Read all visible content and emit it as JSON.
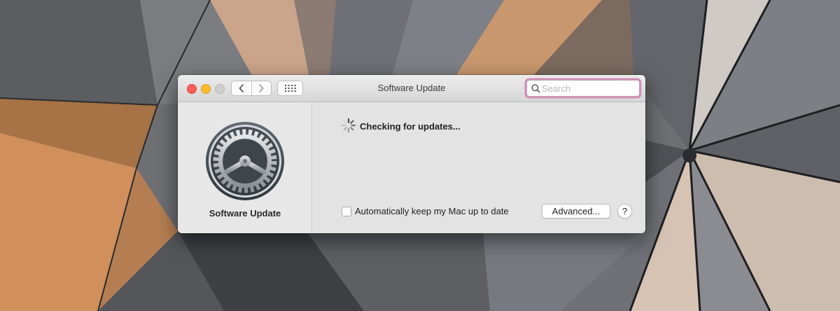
{
  "window": {
    "title": "Software Update",
    "controls": {
      "close_color": "#fc5f57",
      "minimize_color": "#fdbc2e",
      "zoom_color": "#cfcfcf"
    }
  },
  "toolbar": {
    "back_icon": "chevron-left-icon",
    "forward_icon": "chevron-right-icon",
    "show_all_icon": "grid-icon",
    "search": {
      "placeholder": "Search",
      "value": "",
      "focus_ring_color": "#d590b8"
    }
  },
  "sidebar": {
    "icon": "gear-icon",
    "pane_name": "Software Update"
  },
  "content": {
    "status_icon": "spinner-icon",
    "status_text": "Checking for updates...",
    "auto_update": {
      "label": "Automatically keep my Mac up to date",
      "checked": false
    },
    "advanced_label": "Advanced...",
    "help_label": "?"
  }
}
